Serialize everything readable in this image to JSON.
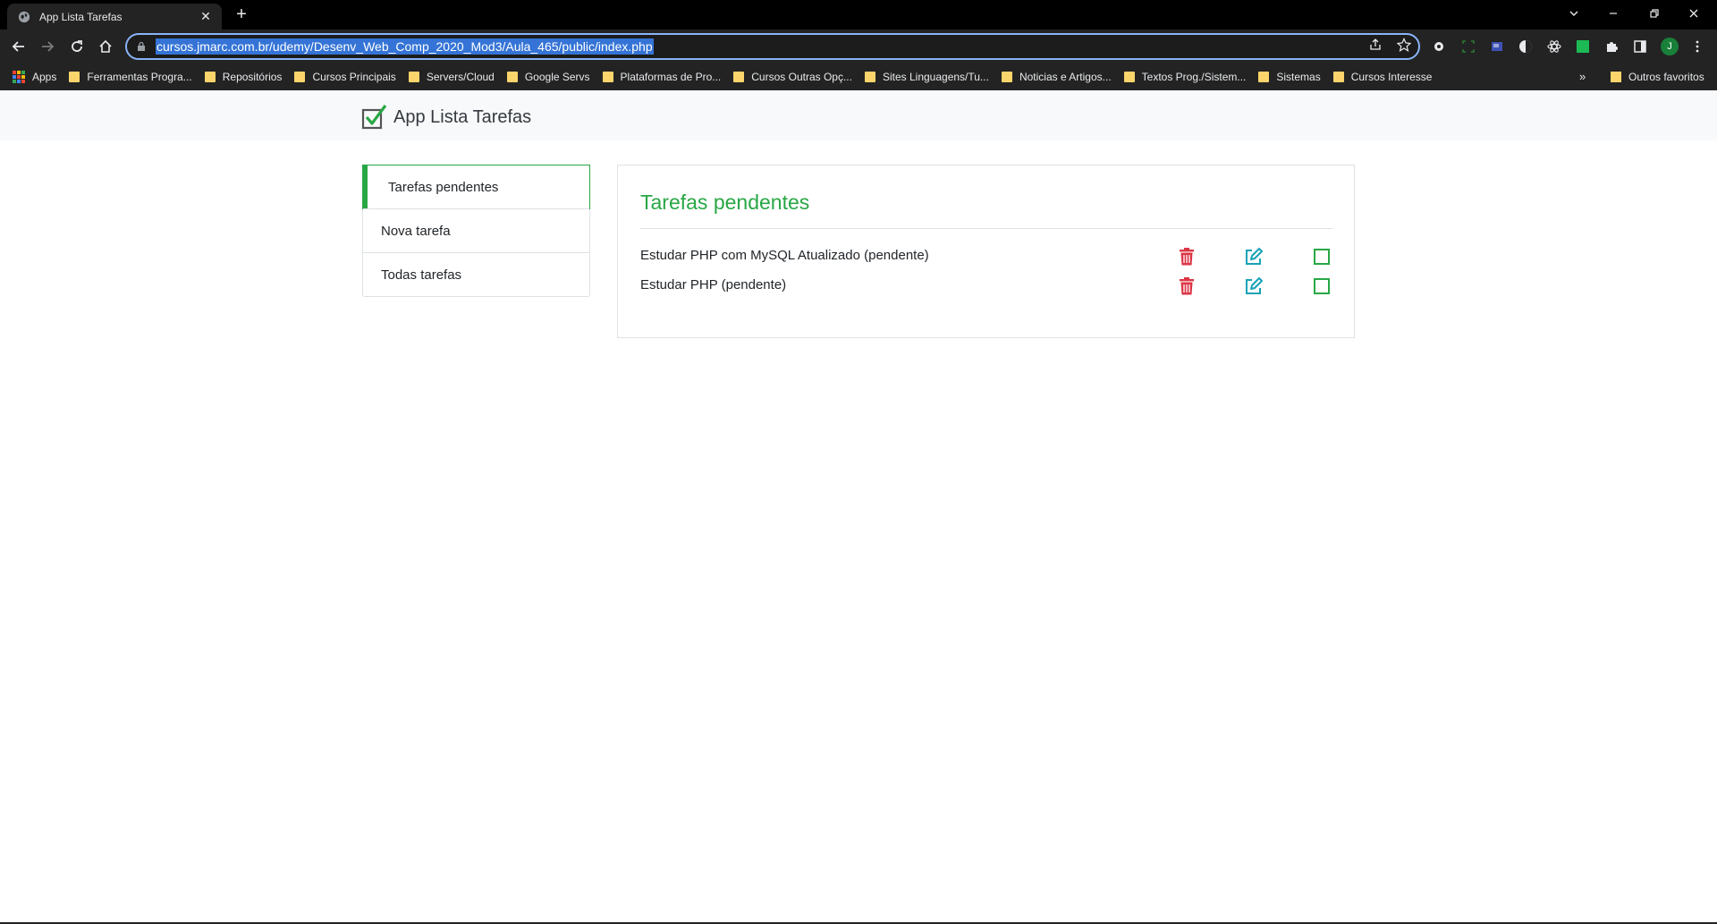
{
  "browser": {
    "tab": {
      "title": "App Lista Tarefas",
      "close": "✕"
    },
    "new_tab": "+",
    "url": "cursos.jmarc.com.br/udemy/Desenv_Web_Comp_2020_Mod3/Aula_465/public/index.php",
    "profile_initial": "J",
    "bookmarks": [
      {
        "label": "Apps",
        "kind": "apps"
      },
      {
        "label": "Ferramentas Progra...",
        "kind": "folder"
      },
      {
        "label": "Repositórios",
        "kind": "folder"
      },
      {
        "label": "Cursos Principais",
        "kind": "folder"
      },
      {
        "label": "Servers/Cloud",
        "kind": "folder"
      },
      {
        "label": "Google Servs",
        "kind": "folder"
      },
      {
        "label": "Plataformas de Pro...",
        "kind": "folder"
      },
      {
        "label": "Cursos Outras Opç...",
        "kind": "folder"
      },
      {
        "label": "Sites Linguagens/Tu...",
        "kind": "folder"
      },
      {
        "label": "Noticias e Artigos...",
        "kind": "folder"
      },
      {
        "label": "Textos Prog./Sistem...",
        "kind": "folder"
      },
      {
        "label": "Sistemas",
        "kind": "folder"
      },
      {
        "label": "Cursos Interesse",
        "kind": "folder"
      }
    ],
    "bookmarks_overflow": "»",
    "other_bookmarks": "Outros favoritos"
  },
  "header": {
    "brand": "App Lista Tarefas"
  },
  "sidebar": {
    "items": [
      {
        "label": "Tarefas pendentes",
        "active": true
      },
      {
        "label": "Nova tarefa",
        "active": false
      },
      {
        "label": "Todas tarefas",
        "active": false
      }
    ]
  },
  "main": {
    "title": "Tarefas pendentes",
    "tasks": [
      {
        "text": "Estudar PHP com MySQL Atualizado (pendente)"
      },
      {
        "text": "Estudar PHP (pendente)"
      }
    ],
    "icons": {
      "delete": "trash-icon",
      "edit": "edit-icon",
      "complete": "checkbox-icon"
    }
  },
  "colors": {
    "accent": "#28a745",
    "delete": "#dc3545",
    "edit": "#17a2b8",
    "complete": "#28a745",
    "chrome_bg": "#232323",
    "bookmark_folder": "#fbd56c"
  }
}
